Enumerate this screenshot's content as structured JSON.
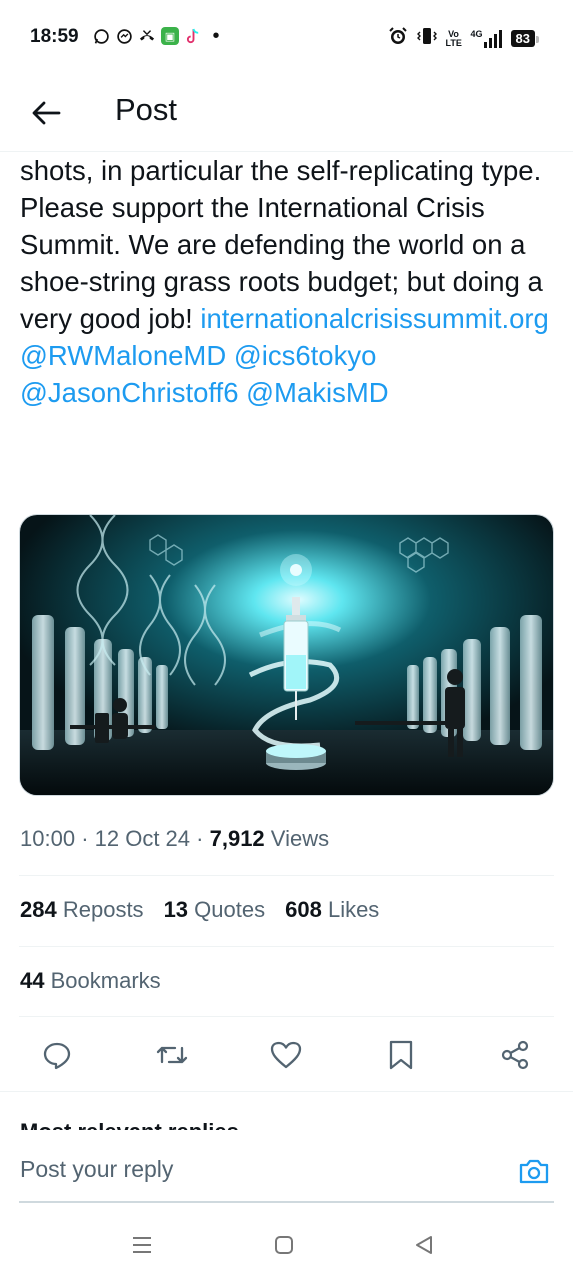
{
  "status_bar": {
    "time": "18:59",
    "battery": "83",
    "network": "4G",
    "volte": "Vo LTE"
  },
  "header": {
    "title": "Post"
  },
  "post": {
    "text_plain": "shots, in particular the self-replicating type.\nPlease support the International Crisis Summit. We are defending the world on a shoe-string grass roots budget; but doing a very good job! ",
    "link_url": "internationalcrisissummit.org",
    "mentions": [
      "@RWMaloneMD",
      "@ics6tokyo",
      "@JasonChristoff6",
      "@MakisMD"
    ],
    "time": "10:00",
    "date": "12 Oct 24",
    "views_count": "7,912",
    "views_label": "Views"
  },
  "stats": {
    "reposts_count": "284",
    "reposts_label": "Reposts",
    "quotes_count": "13",
    "quotes_label": "Quotes",
    "likes_count": "608",
    "likes_label": "Likes",
    "bookmarks_count": "44",
    "bookmarks_label": "Bookmarks"
  },
  "replies": {
    "sort_label": "Most relevant replies",
    "placeholder": "Post your reply"
  },
  "colors": {
    "link": "#1d9bf0",
    "text": "#0f1419",
    "muted": "#536471",
    "divider": "#eff3f4"
  }
}
